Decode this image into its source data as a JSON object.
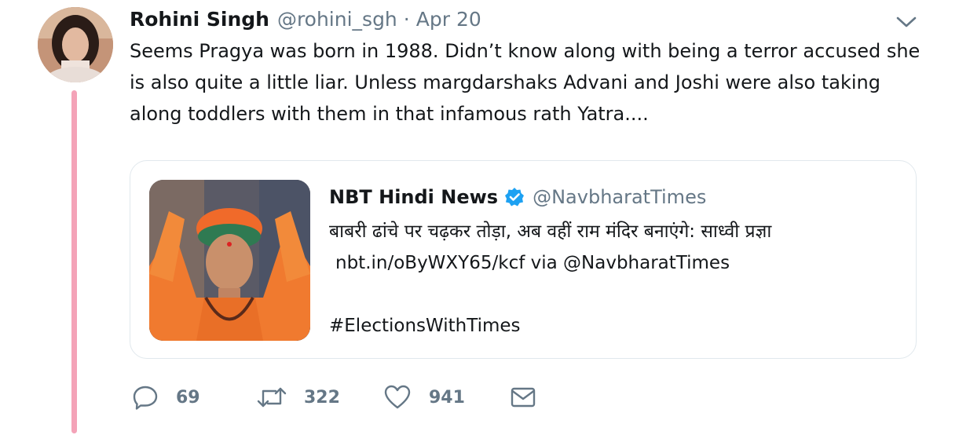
{
  "tweet": {
    "name": "Rohini Singh",
    "handle": "@rohini_sgh",
    "separator": "·",
    "date": "Apr 20",
    "text": "Seems Pragya was born in 1988. Didn’t know along with being a terror accused she is also quite a little liar. Unless margdarshaks Advani and Joshi were also taking along toddlers with them in that infamous rath Yatra....",
    "avatar_icon": "avatar-photo",
    "menu_icon": "chevron-down-icon"
  },
  "quote": {
    "name": "NBT Hindi News",
    "verified_icon": "verified-badge-icon",
    "handle": "@NavbharatTimes",
    "line1": "बाबरी ढांचे पर चढ़कर तोड़ा, अब वहीं राम मंदिर बनाएंगे: साध्वी प्रज्ञा",
    "line2": "nbt.in/oByWXY65/kcf via @NavbharatTimes",
    "hashtag": "#ElectionsWithTimes",
    "image_icon": "quoted-tweet-photo"
  },
  "actions": {
    "reply": {
      "icon": "reply-icon",
      "count": "69"
    },
    "retweet": {
      "icon": "retweet-icon",
      "count": "322"
    },
    "like": {
      "icon": "heart-icon",
      "count": "941"
    },
    "dm": {
      "icon": "envelope-icon"
    }
  },
  "colors": {
    "thread_line": "#f4a3b8",
    "secondary_text": "#657786",
    "verified_blue": "#1da1f2",
    "border": "#e1e8ed"
  }
}
